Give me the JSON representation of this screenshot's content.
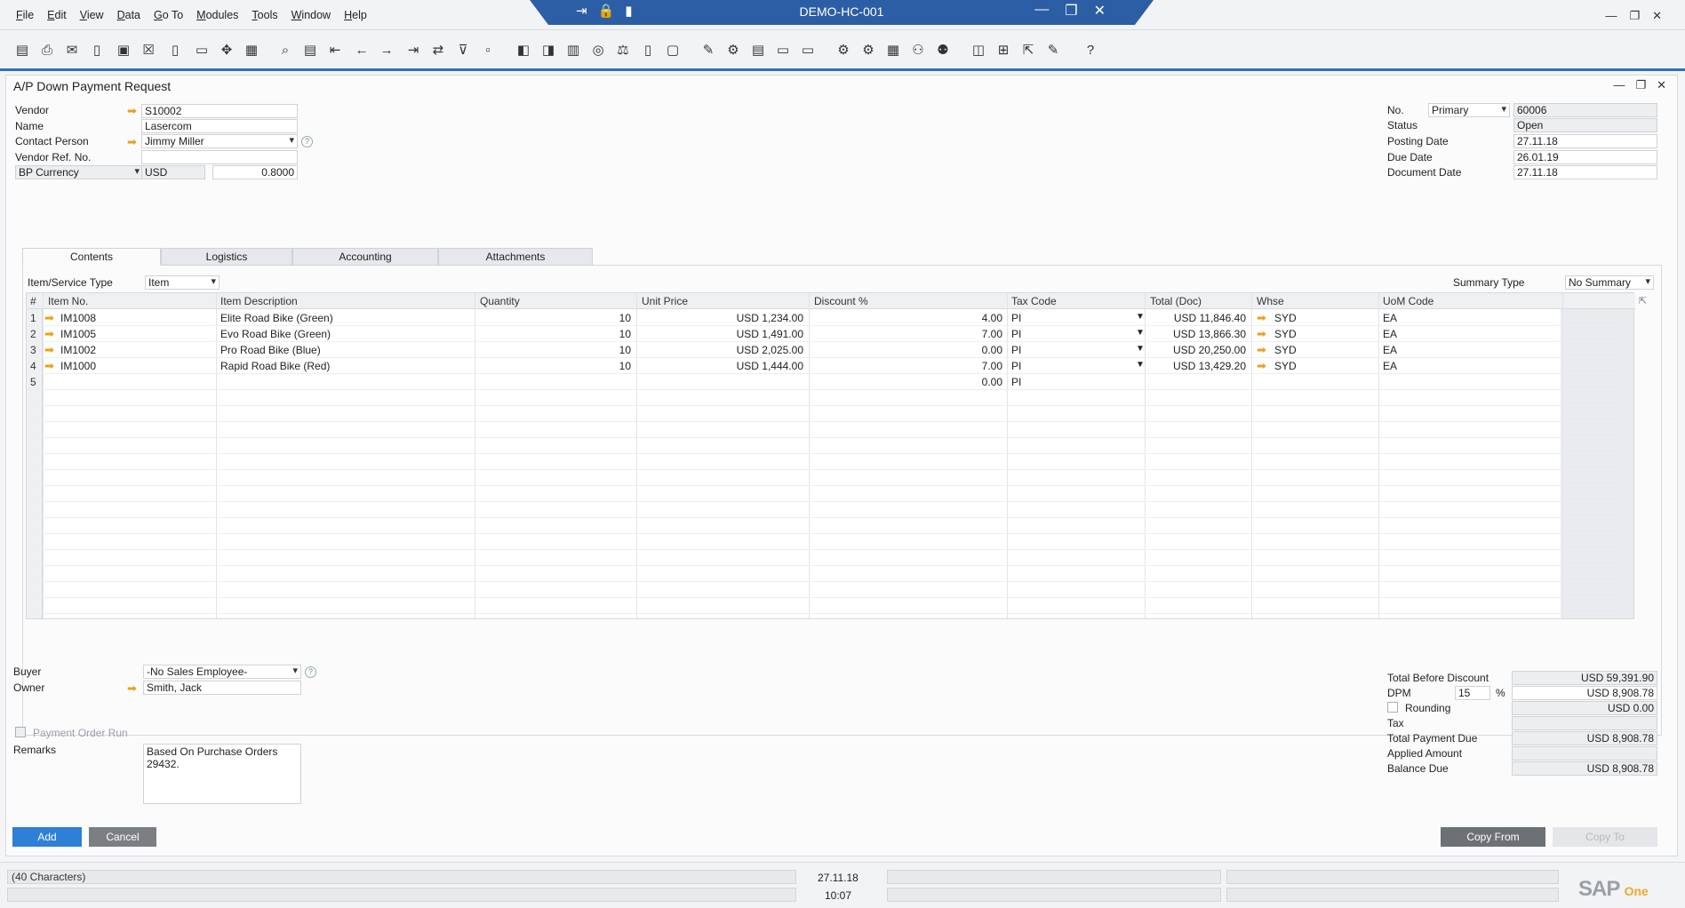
{
  "menu": [
    "File",
    "Edit",
    "View",
    "Data",
    "Go To",
    "Modules",
    "Tools",
    "Window",
    "Help"
  ],
  "window_title": "DEMO-HC-001",
  "document_title": "A/P Down Payment Request",
  "header_left": {
    "vendor_label": "Vendor",
    "vendor_value": "S10002",
    "name_label": "Name",
    "name_value": "Lasercom",
    "contact_label": "Contact Person",
    "contact_value": "Jimmy Miller",
    "ref_label": "Vendor Ref. No.",
    "ref_value": "",
    "currency_label": "BP Currency",
    "currency_value": "USD",
    "rate_value": "0.8000"
  },
  "header_right": {
    "no_label": "No.",
    "series_value": "Primary",
    "no_value": "60006",
    "status_label": "Status",
    "status_value": "Open",
    "posting_label": "Posting Date",
    "posting_value": "27.11.18",
    "due_label": "Due Date",
    "due_value": "26.01.19",
    "docdate_label": "Document Date",
    "docdate_value": "27.11.18"
  },
  "tabs": [
    "Contents",
    "Logistics",
    "Accounting",
    "Attachments"
  ],
  "contents": {
    "item_type_label": "Item/Service Type",
    "item_type_value": "Item",
    "summary_label": "Summary Type",
    "summary_value": "No Summary"
  },
  "grid": {
    "columns": [
      "#",
      "Item No.",
      "Item Description",
      "Quantity",
      "Unit Price",
      "Discount %",
      "Tax Code",
      "Total (Doc)",
      "Whse",
      "UoM Code"
    ],
    "rows": [
      {
        "n": "1",
        "item": "IM1008",
        "desc": "Elite Road Bike (Green)",
        "qty": "10",
        "price": "USD 1,234.00",
        "disc": "4.00",
        "tax": "PI",
        "total": "USD 11,846.40",
        "whse": "SYD",
        "uom": "EA"
      },
      {
        "n": "2",
        "item": "IM1005",
        "desc": "Evo Road Bike (Green)",
        "qty": "10",
        "price": "USD 1,491.00",
        "disc": "7.00",
        "tax": "PI",
        "total": "USD 13,866.30",
        "whse": "SYD",
        "uom": "EA"
      },
      {
        "n": "3",
        "item": "IM1002",
        "desc": "Pro Road Bike (Blue)",
        "qty": "10",
        "price": "USD 2,025.00",
        "disc": "0.00",
        "tax": "PI",
        "total": "USD 20,250.00",
        "whse": "SYD",
        "uom": "EA"
      },
      {
        "n": "4",
        "item": "IM1000",
        "desc": "Rapid Road Bike (Red)",
        "qty": "10",
        "price": "USD 1,444.00",
        "disc": "7.00",
        "tax": "PI",
        "total": "USD 13,429.20",
        "whse": "SYD",
        "uom": "EA"
      },
      {
        "n": "5",
        "item": "",
        "desc": "",
        "qty": "",
        "price": "",
        "disc": "0.00",
        "tax": "PI",
        "total": "",
        "whse": "",
        "uom": ""
      }
    ]
  },
  "footer_left": {
    "buyer_label": "Buyer",
    "buyer_value": "-No Sales Employee-",
    "owner_label": "Owner",
    "owner_value": "Smith, Jack",
    "payment_run_label": "Payment Order Run",
    "remarks_label": "Remarks",
    "remarks_value": "Based On Purchase Orders 29432."
  },
  "totals": {
    "before_discount_label": "Total Before Discount",
    "before_discount_value": "USD 59,391.90",
    "dpm_label": "DPM",
    "dpm_percent": "15",
    "dpm_pct_sign": "%",
    "dpm_value": "USD 8,908.78",
    "rounding_label": "Rounding",
    "rounding_value": "USD 0.00",
    "tax_label": "Tax",
    "tax_value": "",
    "payment_due_label": "Total Payment Due",
    "payment_due_value": "USD 8,908.78",
    "applied_label": "Applied Amount",
    "applied_value": "",
    "balance_label": "Balance Due",
    "balance_value": "USD 8,908.78"
  },
  "buttons": {
    "add": "Add",
    "cancel": "Cancel",
    "copy_from": "Copy From",
    "copy_to": "Copy To"
  },
  "status_bar": {
    "message": "(40 Characters)",
    "date": "27.11.18",
    "time": "10:07"
  },
  "logo": {
    "sap": "SAP",
    "product": "One"
  }
}
